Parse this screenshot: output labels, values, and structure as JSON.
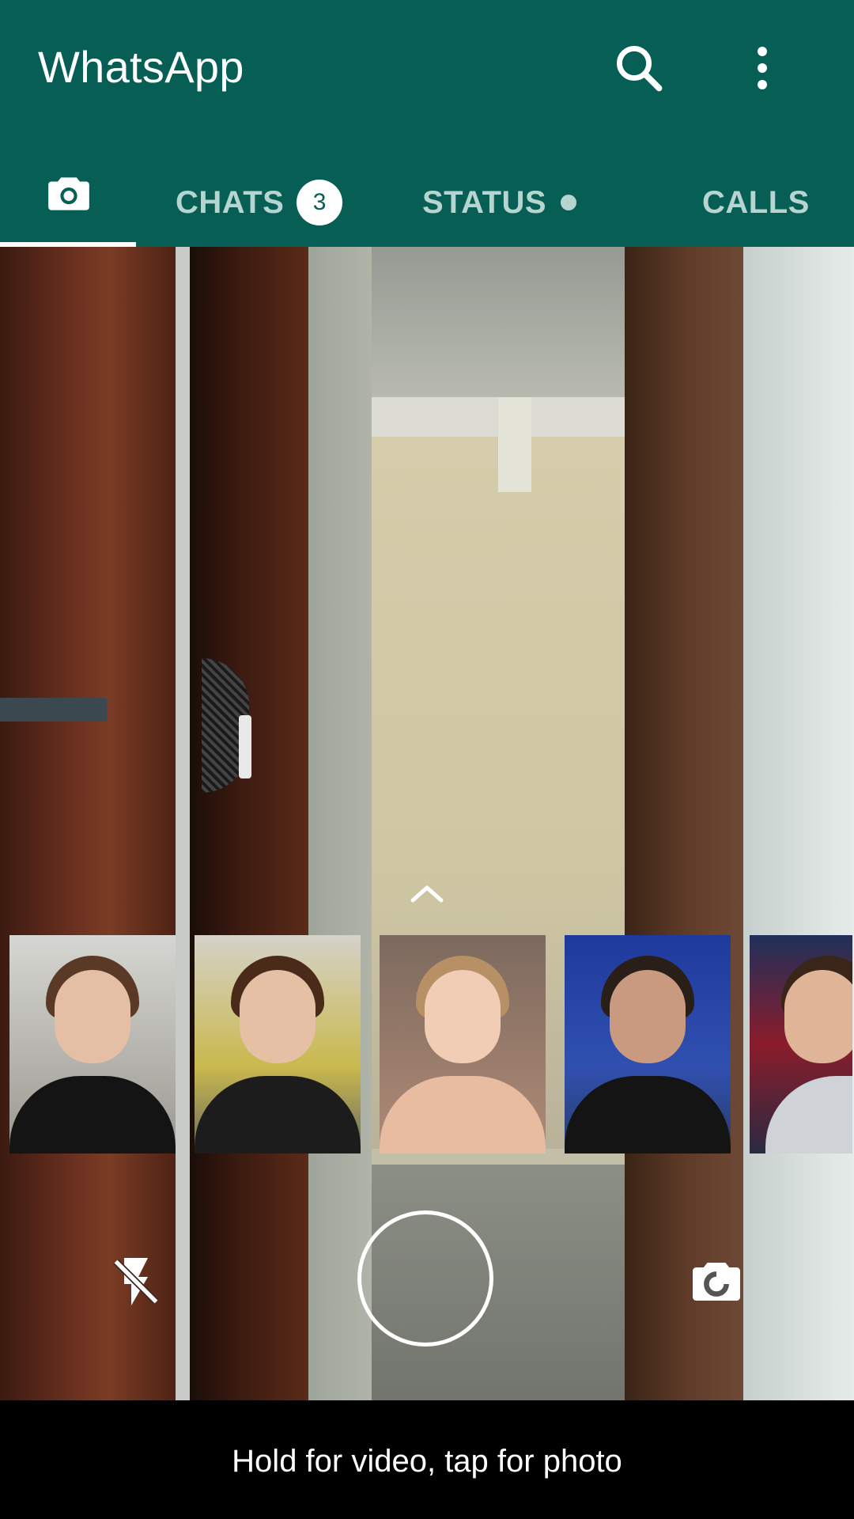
{
  "app_bar": {
    "title": "WhatsApp",
    "background_color": "#075e54",
    "search_icon": "search-icon",
    "menu_icon": "more-vert-icon"
  },
  "tabs": {
    "camera_icon": "camera-icon",
    "chats": {
      "label": "CHATS",
      "badge": "3"
    },
    "status": {
      "label": "STATUS"
    },
    "calls": {
      "label": "CALLS"
    },
    "active": "camera"
  },
  "camera": {
    "expand_icon": "chevron-up-icon",
    "recent_photos_count": 5,
    "flash_icon": "flash-off-icon",
    "shutter_icon": "shutter-circle",
    "flip_icon": "switch-camera-icon"
  },
  "footer": {
    "hint": "Hold for video, tap for photo"
  }
}
